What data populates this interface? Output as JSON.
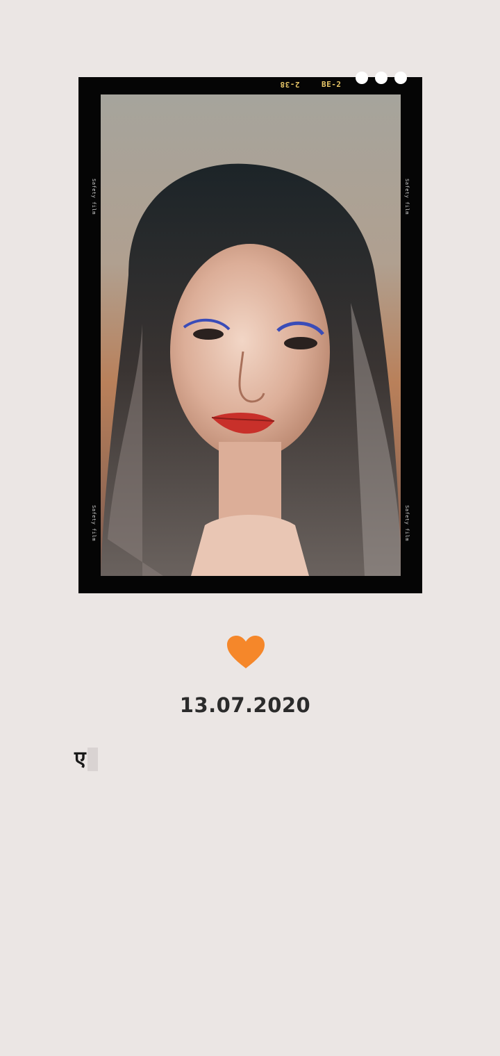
{
  "film_frame": {
    "code_left": "2-38",
    "code_right": "BE-2",
    "side_mark": "Safety film"
  },
  "photo": {
    "subject": "portrait-photo"
  },
  "icons": {
    "heart": "heart-icon",
    "heart_color": "#f5872a"
  },
  "date": "13.07.2020",
  "typed_text": "ए",
  "colors": {
    "background": "#ebe6e4",
    "frame": "#050505",
    "frame_code": "#e9c768"
  }
}
